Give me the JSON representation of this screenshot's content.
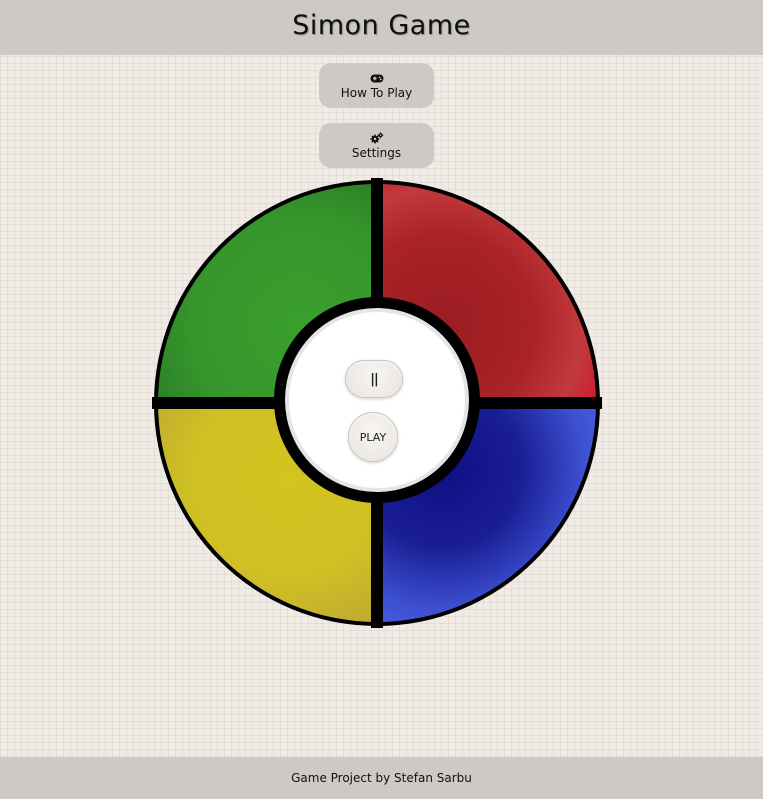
{
  "header": {
    "title": "Simon Game"
  },
  "menu": {
    "how_to_play": {
      "icon": "gamepad-icon",
      "label": "How To Play"
    },
    "settings": {
      "icon": "gears-icon",
      "label": "Settings"
    }
  },
  "board": {
    "pads": [
      {
        "name": "green-pad",
        "color": "#379a2c"
      },
      {
        "name": "red-pad",
        "color": "#b92029"
      },
      {
        "name": "yellow-pad",
        "color": "#d4c421"
      },
      {
        "name": "blue-pad",
        "color": "#1a1c96"
      }
    ],
    "controls": {
      "pause_label": "||",
      "play_label": "PLAY"
    }
  },
  "footer": {
    "credit": "Game Project by Stefan Sarbu"
  }
}
